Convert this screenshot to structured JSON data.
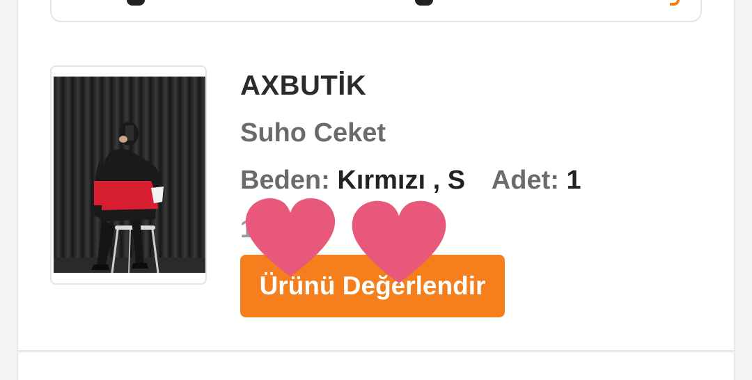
{
  "order_item": {
    "brand": "AXBUTİK",
    "product_name": "Suho Ceket",
    "size_label": "Beden:",
    "size_value": "Kırmızı , S",
    "quantity_label": "Adet:",
    "quantity_value": "1",
    "price": "1 ... ₺",
    "rate_button_label": "Ürünü Değerlendir"
  },
  "colors": {
    "accent": "#f47f1c",
    "heart": "#e8587a",
    "brand_text": "#2b2b2b",
    "muted_text": "#6b6b6b"
  },
  "icons": [
    "heart-sticker-icon",
    "heart-sticker-icon"
  ]
}
